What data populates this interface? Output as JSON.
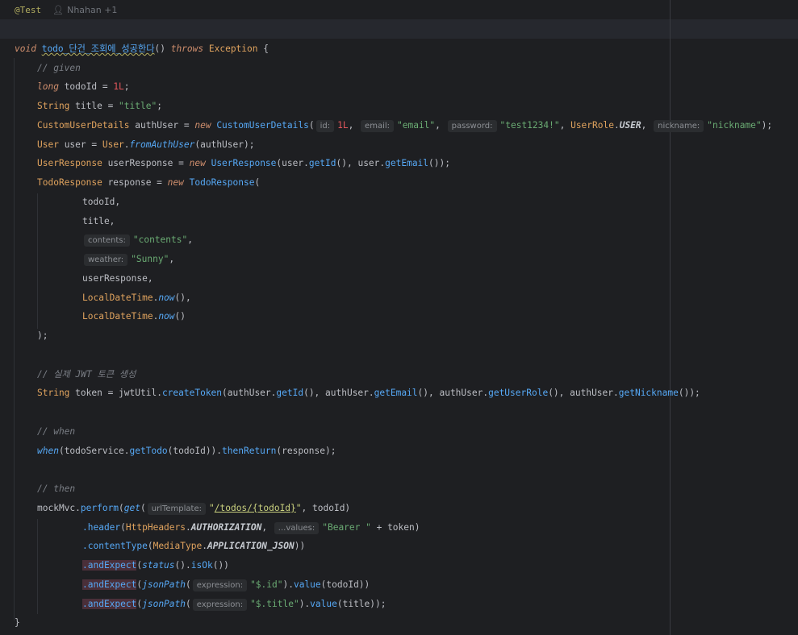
{
  "meta": {
    "annotation": "@Test",
    "author": "Nhahan +1"
  },
  "colors": {
    "background": "#1e1f22",
    "keyword": "#cf8e6d",
    "string": "#6aab73",
    "method": "#56a8f5",
    "comment": "#7a7e85"
  },
  "code": {
    "sig_void": "void",
    "sig_name": "todo_단건_조회에_성공한다",
    "sig_parens": "() ",
    "sig_throws": "throws",
    "sig_exc": "Exception",
    "sig_brace": " {",
    "c_given": "// given",
    "l2_type": "long",
    "l2_rest": " todoId = ",
    "l2_val": "1L",
    "l3_type": "String",
    "l3_rest": " title = ",
    "l3_str": "\"title\"",
    "l4_type": "CustomUserDetails",
    "l4_rest": " authUser = ",
    "l4_new": "new",
    "l4_ctor": "CustomUserDetails",
    "l4_h1": "id:",
    "l4_v1": "1L",
    "l4_h2": "email:",
    "l4_v2": "\"email\"",
    "l4_h3": "password:",
    "l4_v3": "\"test1234!\"",
    "l4_role": "UserRole",
    "l4_user": "USER",
    "l4_h4": "nickname:",
    "l4_v4": "\"nickname\"",
    "l5_type": "User",
    "l5_rest": " user = ",
    "l5_cls": "User",
    "l5_fn": "fromAuthUser",
    "l5_arg": "(authUser);",
    "l6_type": "UserResponse",
    "l6_rest": " userResponse = ",
    "l6_new": "new",
    "l6_ctor": "UserResponse",
    "l6_a": "(user.",
    "l6_f1": "getId",
    "l6_b": "(), user.",
    "l6_f2": "getEmail",
    "l6_c": "());",
    "l7_type": "TodoResponse",
    "l7_rest": " response = ",
    "l7_new": "new",
    "l7_ctor": "TodoResponse",
    "l8": "todoId,",
    "l9": "title,",
    "l10_h": "contents:",
    "l10_v": "\"contents\"",
    "l11_h": "weather:",
    "l11_v": "\"Sunny\"",
    "l12": "userResponse,",
    "l13_cls": "LocalDateTime",
    "l13_fn": "now",
    "l14_cls": "LocalDateTime",
    "l14_fn": "now",
    "l15": ");",
    "c_jwt": "// 실제 JWT 토큰 생성",
    "l16_type": "String",
    "l16_rest": " token = jwtUtil.",
    "l16_f1": "createToken",
    "l16_a": "(authUser.",
    "l16_f2": "getId",
    "l16_b": "(), authUser.",
    "l16_f3": "getEmail",
    "l16_c": "(), authUser.",
    "l16_f4": "getUserRole",
    "l16_d": "(), authUser.",
    "l16_f5": "getNickname",
    "l16_e": "());",
    "c_when": "// when",
    "l17_when": "when",
    "l17_a": "(todoService.",
    "l17_f1": "getTodo",
    "l17_b": "(todoId)).",
    "l17_f2": "thenReturn",
    "l17_c": "(response);",
    "c_then": "// then",
    "l18_a": "mockMvc.",
    "l18_f1": "perform",
    "l18_get": "get",
    "l18_h": "urlTemplate:",
    "l18_q1": "\"",
    "l18_url": "/todos/{todoId}",
    "l18_q2": "\"",
    "l18_b": ", todoId)",
    "l19_f": ".header",
    "l19_cls": "HttpHeaders",
    "l19_const": "AUTHORIZATION",
    "l19_h": "...values:",
    "l19_v": "\"Bearer \"",
    "l19_b": " + token)",
    "l20_f": ".contentType",
    "l20_cls": "MediaType",
    "l20_const": "APPLICATION_JSON",
    "l21_f": ".andExpect",
    "l21_st": "status",
    "l21_b": "().",
    "l21_ok": "isOk",
    "l21_c": "())",
    "l22_f": ".andExpect",
    "l22_jp": "jsonPath",
    "l22_h": "expression:",
    "l22_v": "\"$.id\"",
    "l22_val": "value",
    "l22_c": "(todoId))",
    "l23_f": ".andExpect",
    "l23_jp": "jsonPath",
    "l23_h": "expression:",
    "l23_v": "\"$.title\"",
    "l23_val": "value",
    "l23_c": "(title));",
    "end": "}"
  }
}
